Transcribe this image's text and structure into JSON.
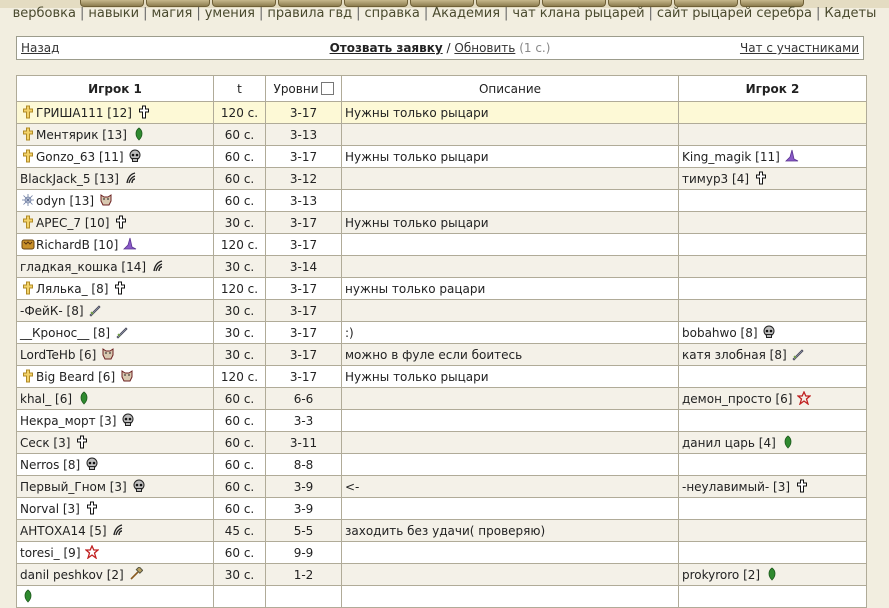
{
  "nav": {
    "links": [
      "вербовка",
      "навыки",
      "магия",
      "умения",
      "правила гвд",
      "справка",
      "Академия",
      "чат клана рыцарей",
      "сайт рыцарей серебра",
      "Кадеты"
    ]
  },
  "bar": {
    "back": "Назад",
    "withdraw": "Отозвать заявку",
    "slash": "/",
    "refresh": "Обновить",
    "timer": "(1 с.)",
    "chat": "Чат с участниками"
  },
  "table": {
    "headers": {
      "player1": "Игрок 1",
      "t": "t",
      "levels": "Уровни",
      "desc": "Описание",
      "player2": "Игрок 2"
    },
    "rows": [
      {
        "p1": "ГРИША111 [12]",
        "p1_lead": "cross-gold",
        "p1_icon": "cross",
        "t": "120 с.",
        "lv": "3-17",
        "desc": "Нужны только рыцари",
        "p2": "",
        "p2_icon": ""
      },
      {
        "p1": "Ментярик [13]",
        "p1_lead": "cross-gold",
        "p1_icon": "leaf",
        "t": "60 с.",
        "lv": "3-13",
        "desc": "",
        "p2": "",
        "p2_icon": ""
      },
      {
        "p1": "Gonzo_63 [11]",
        "p1_lead": "cross-gold",
        "p1_icon": "skull",
        "t": "60 с.",
        "lv": "3-17",
        "desc": "Нужны только рыцари",
        "p2": "King_magik [11]",
        "p2_icon": "hat"
      },
      {
        "p1": "BlackJack_5 [13]",
        "p1_lead": "",
        "p1_icon": "claw",
        "t": "60 с.",
        "lv": "3-12",
        "desc": "",
        "p2": "тимур3 [4]",
        "p2_icon": "cross"
      },
      {
        "p1": "odyn [13]",
        "p1_lead": "web",
        "p1_icon": "mask",
        "t": "60 с.",
        "lv": "3-13",
        "desc": "",
        "p2": "",
        "p2_icon": ""
      },
      {
        "p1": "APEC_7 [10]",
        "p1_lead": "cross-gold",
        "p1_icon": "cross",
        "t": "30 с.",
        "lv": "3-17",
        "desc": "Нужны только рыцари",
        "p2": "",
        "p2_icon": ""
      },
      {
        "p1": "RichardB [10]",
        "p1_lead": "beast",
        "p1_icon": "hat",
        "t": "120 с.",
        "lv": "3-17",
        "desc": "",
        "p2": "",
        "p2_icon": ""
      },
      {
        "p1": "гладкая_кошка [14]",
        "p1_lead": "",
        "p1_icon": "claw",
        "t": "30 с.",
        "lv": "3-14",
        "desc": "",
        "p2": "",
        "p2_icon": ""
      },
      {
        "p1": "Лялька_ [8]",
        "p1_lead": "cross-gold",
        "p1_icon": "cross",
        "t": "120 с.",
        "lv": "3-17",
        "desc": "нужны только рацари",
        "p2": "",
        "p2_icon": ""
      },
      {
        "p1": "-ФейК- [8]",
        "p1_lead": "",
        "p1_icon": "sword",
        "t": "30 с.",
        "lv": "3-17",
        "desc": "",
        "p2": "",
        "p2_icon": ""
      },
      {
        "p1": "__Кронос__ [8]",
        "p1_lead": "",
        "p1_icon": "sword",
        "t": "30 с.",
        "lv": "3-17",
        "desc": ":)",
        "p2": "bobahwo [8]",
        "p2_icon": "skull"
      },
      {
        "p1": "LordTeHb [6]",
        "p1_lead": "",
        "p1_icon": "mask",
        "t": "30 с.",
        "lv": "3-17",
        "desc": "можно в фуле если боитесь",
        "p2": "катя злобная [8]",
        "p2_icon": "sword"
      },
      {
        "p1": "Big Beard [6]",
        "p1_lead": "cross-gold",
        "p1_icon": "mask",
        "t": "120 с.",
        "lv": "3-17",
        "desc": "Нужны только рыцари",
        "p2": "",
        "p2_icon": ""
      },
      {
        "p1": "khal_ [6]",
        "p1_lead": "",
        "p1_icon": "leaf",
        "t": "60 с.",
        "lv": "6-6",
        "desc": "",
        "p2": "демон_просто [6]",
        "p2_icon": "star"
      },
      {
        "p1": "Некра_морт [3]",
        "p1_lead": "",
        "p1_icon": "skull",
        "t": "60 с.",
        "lv": "3-3",
        "desc": "",
        "p2": "",
        "p2_icon": ""
      },
      {
        "p1": "Сеск [3]",
        "p1_lead": "",
        "p1_icon": "cross",
        "t": "60 с.",
        "lv": "3-11",
        "desc": "",
        "p2": "данил царь [4]",
        "p2_icon": "leaf"
      },
      {
        "p1": "Nerros [8]",
        "p1_lead": "",
        "p1_icon": "skull",
        "t": "60 с.",
        "lv": "8-8",
        "desc": "",
        "p2": "",
        "p2_icon": ""
      },
      {
        "p1": "Первый_Гном [3]",
        "p1_lead": "",
        "p1_icon": "skull",
        "t": "60 с.",
        "lv": "3-9",
        "desc": "<-",
        "p2": "-неулавимый- [3]",
        "p2_icon": "cross"
      },
      {
        "p1": "Norval [3]",
        "p1_lead": "",
        "p1_icon": "cross",
        "t": "60 с.",
        "lv": "3-9",
        "desc": "",
        "p2": "",
        "p2_icon": ""
      },
      {
        "p1": "АНТОХА14 [5]",
        "p1_lead": "",
        "p1_icon": "claw",
        "t": "45 с.",
        "lv": "5-5",
        "desc": "заходить без удачи( проверяю)",
        "p2": "",
        "p2_icon": ""
      },
      {
        "p1": "toresi_ [9]",
        "p1_lead": "",
        "p1_icon": "star",
        "t": "60 с.",
        "lv": "9-9",
        "desc": "",
        "p2": "",
        "p2_icon": ""
      },
      {
        "p1": "danil peshkov [2]",
        "p1_lead": "",
        "p1_icon": "hammer",
        "t": "30 с.",
        "lv": "1-2",
        "desc": "",
        "p2": "prokyroro [2]",
        "p2_icon": "leaf"
      },
      {
        "p1": "",
        "p1_lead": "",
        "p1_icon": "leaf",
        "t": "",
        "lv": "",
        "desc": "",
        "p2": "",
        "p2_icon": ""
      }
    ]
  }
}
